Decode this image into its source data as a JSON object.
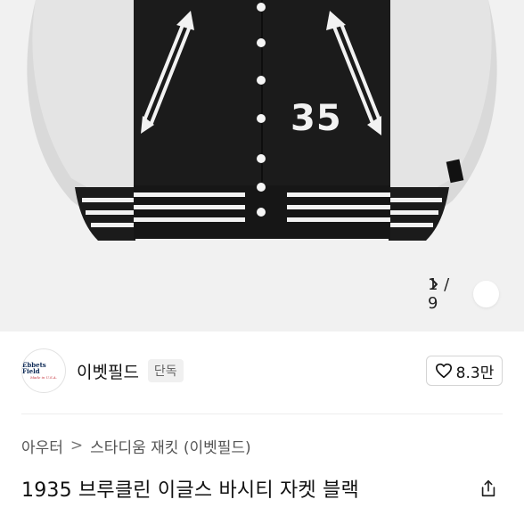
{
  "gallery": {
    "image_alt": "Varsity jacket product photo",
    "jersey_number": "35",
    "counter": "1 / 9",
    "next_icon": "chevron-right-icon"
  },
  "seller": {
    "logo_text": "Ebbets Field",
    "logo_subtext": "Made in U.S.A.",
    "name": "이벳필드",
    "badge": "단독",
    "likes": "8.3만",
    "like_icon": "heart-outline-icon"
  },
  "breadcrumb": {
    "category": "아우터",
    "separator": ">",
    "subcategory": "스타디움 재킷 (이벳필드)"
  },
  "product": {
    "title": "1935 브루클린 이글스 바시티 자켓 블랙",
    "share_icon": "share-icon"
  },
  "colors": {
    "background": "#ffffff",
    "hero_bg": "#f1f1f1",
    "jacket_body": "#1b1b1b",
    "jacket_sleeve": "#dcdcdc"
  }
}
